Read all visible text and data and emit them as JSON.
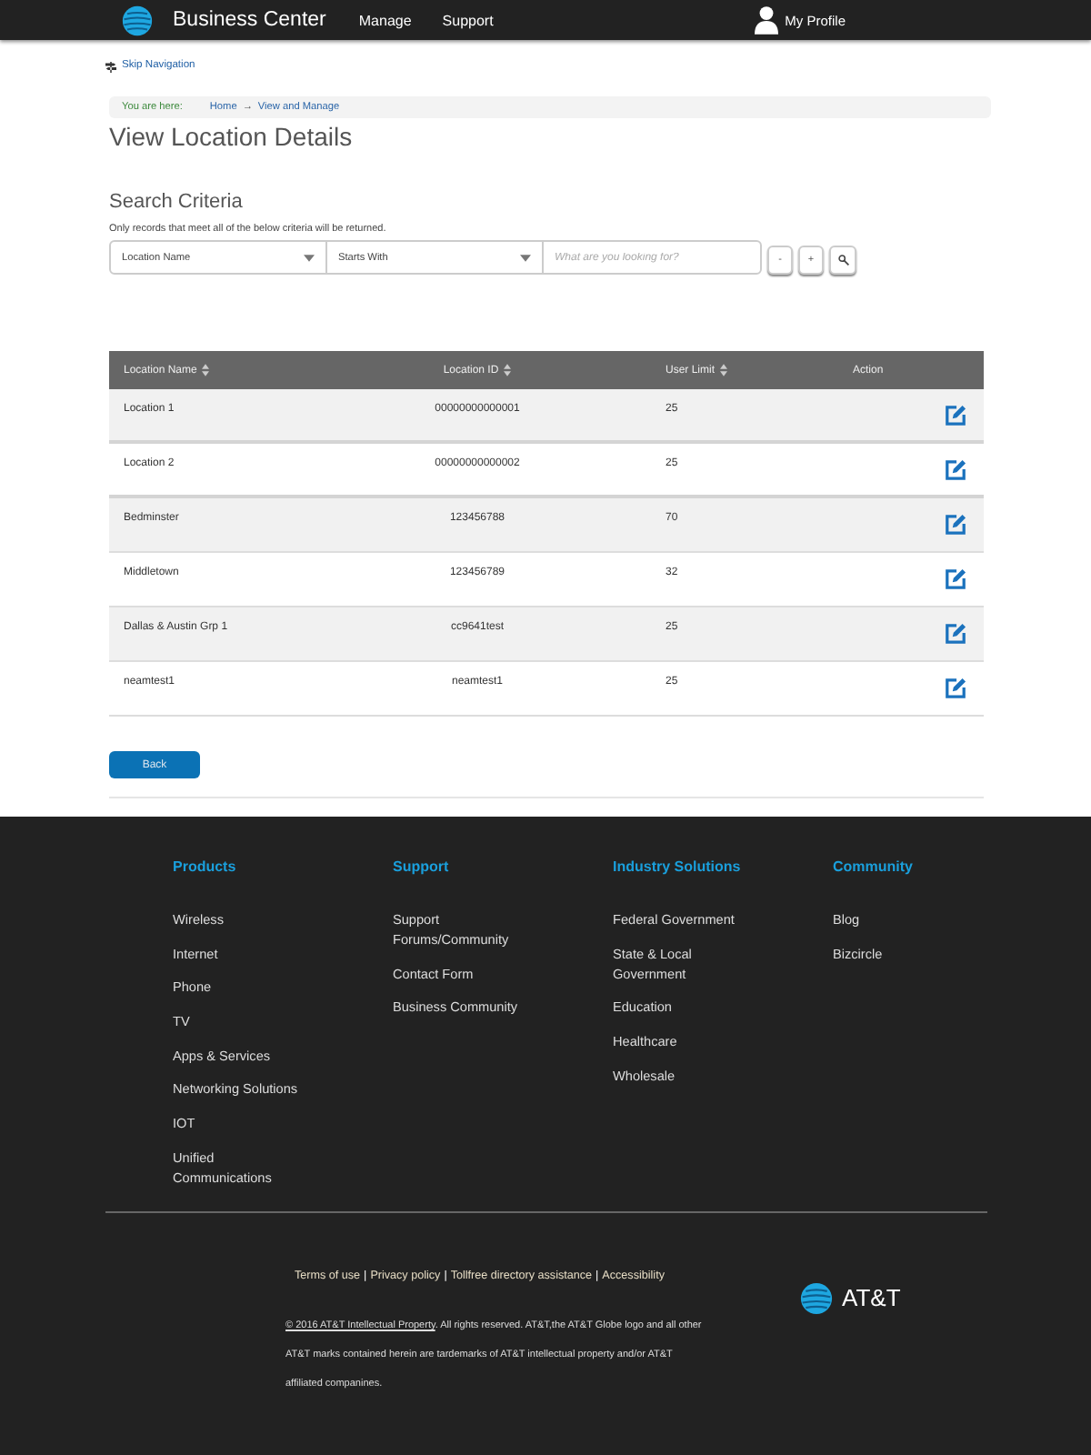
{
  "header": {
    "brand": "Business Center",
    "nav": [
      {
        "label": "Manage"
      },
      {
        "label": "Support"
      }
    ],
    "profile": "My Profile"
  },
  "skip_link": "Skip Navigation",
  "breadcrumb": {
    "label": "You are here:",
    "separator": "→",
    "links": [
      "Home",
      "View and Manage"
    ]
  },
  "page_title": "View Location Details",
  "search": {
    "title": "Search Criteria",
    "hint": "Only records that meet all of the below criteria will be returned.",
    "field": "Location Name",
    "operator": "Starts With",
    "placeholder": "What are you looking for?",
    "buttons": [
      {
        "kind": "text",
        "label": "-"
      },
      {
        "kind": "text",
        "label": "+"
      },
      {
        "kind": "search"
      }
    ]
  },
  "table": {
    "columns": [
      {
        "label": "Location Name",
        "sortable": true
      },
      {
        "label": "Location ID",
        "sortable": true
      },
      {
        "label": "User Limit",
        "sortable": true
      },
      {
        "label": "Action",
        "sortable": false
      }
    ],
    "rows": [
      {
        "name": "Location 1",
        "location_id": "00000000000001",
        "user_limit": "25"
      },
      {
        "name": "Location 2",
        "location_id": "00000000000002",
        "user_limit": "25"
      },
      {
        "name": "Bedminster",
        "location_id": "123456788",
        "user_limit": "70"
      },
      {
        "name": "Middletown",
        "location_id": "123456789",
        "user_limit": "32"
      },
      {
        "name": "Dallas & Austin Grp 1",
        "location_id": "cc9641test",
        "user_limit": "25"
      },
      {
        "name": "neamtest1",
        "location_id": "neamtest1",
        "user_limit": "25"
      }
    ]
  },
  "back_button": "Back",
  "footer": {
    "columns": [
      {
        "title": "Products",
        "links": [
          "Wireless",
          "Internet",
          "Phone",
          "TV",
          "Apps & Services",
          "Networking Solutions",
          "IOT",
          "Unified Communications"
        ]
      },
      {
        "title": "Support",
        "links": [
          "Support Forums/Community",
          "Contact Form",
          "Business Community"
        ]
      },
      {
        "title": "Industry Solutions",
        "links": [
          "Federal Government",
          "State & Local Government",
          "Education",
          "Healthcare",
          "Wholesale"
        ]
      },
      {
        "title": "Community",
        "links": [
          "Blog",
          "Bizcircle"
        ]
      }
    ],
    "legal_links": [
      "Terms of use",
      "Privacy policy",
      "Tollfree directory assistance",
      "Accessibility"
    ],
    "legal_separator": "|",
    "copyright": {
      "link": "© 2016 AT&T Intellectual Property",
      "text": ". All rights reserved. AT&T,the AT&T Globe logo and all other AT&T marks contained herein are tardemarks of AT&T intellectual property and/or AT&T affiliated companines."
    },
    "logo_text": "AT&T"
  }
}
